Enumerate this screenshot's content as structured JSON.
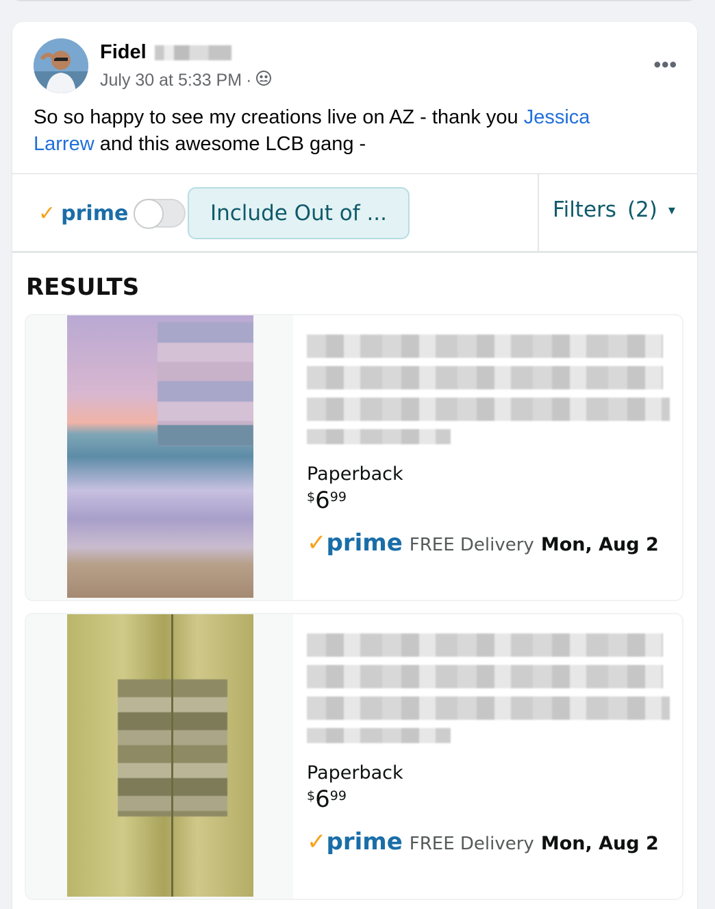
{
  "post": {
    "author": "Fidel",
    "timestamp": "July 30 at 5:33 PM",
    "separator": "·",
    "audience_icon": "friends-icon",
    "more_label": "•••",
    "text_before": "So so happy to see my creations live on AZ - thank you ",
    "mention": "Jessica Larrew",
    "text_after": " and this awesome LCB gang -"
  },
  "amazon": {
    "prime_label": "prime",
    "include_label": "Include Out of ...",
    "filters_label": "Filters",
    "filters_count": "(2)",
    "results_title": "RESULTS",
    "results": [
      {
        "format": "Paperback",
        "price_symbol": "$",
        "price_whole": "6",
        "price_cents": "99",
        "prime_label": "prime",
        "delivery_label": "FREE Delivery",
        "delivery_date": "Mon, Aug 2"
      },
      {
        "format": "Paperback",
        "price_symbol": "$",
        "price_whole": "6",
        "price_cents": "99",
        "prime_label": "prime",
        "delivery_label": "FREE Delivery",
        "delivery_date": "Mon, Aug 2"
      }
    ]
  },
  "colors": {
    "link": "#216fdb",
    "prime_blue": "#1a6ea8",
    "prime_check": "#f6a21b",
    "teal_text": "#0f5a6a"
  }
}
